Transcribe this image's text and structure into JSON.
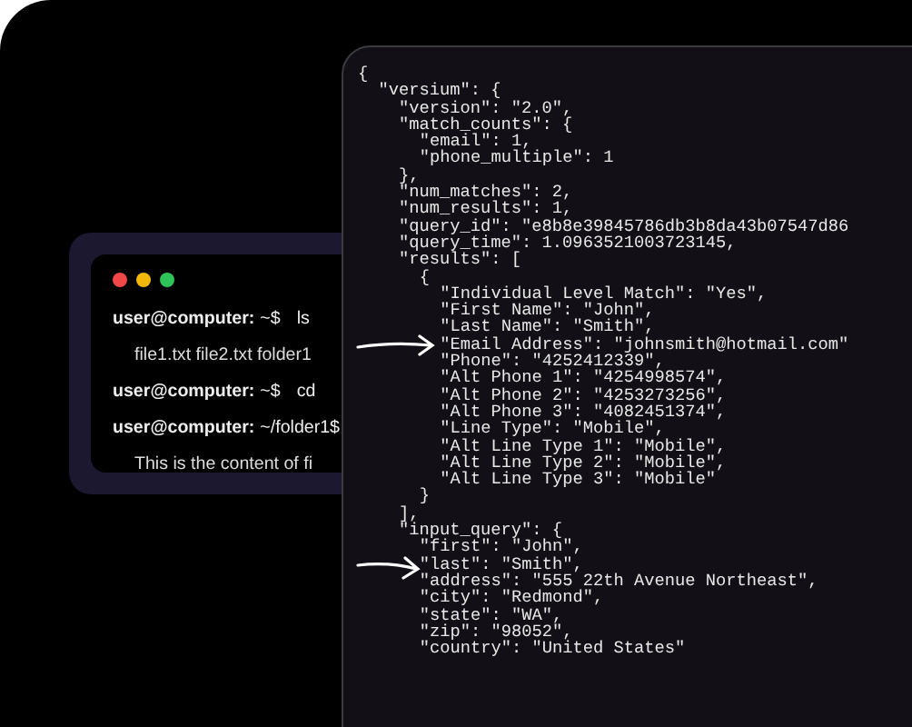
{
  "terminal": {
    "lines": [
      {
        "kind": "prompt",
        "user": "user@computer:",
        "path": "~$",
        "command": "ls"
      },
      {
        "kind": "output",
        "text": "file1.txt file2.txt folder1"
      },
      {
        "kind": "prompt",
        "user": "user@computer:",
        "path": "~$",
        "command": "cd"
      },
      {
        "kind": "prompt",
        "user": "user@computer:",
        "path": "~/folder1$"
      },
      {
        "kind": "output",
        "text": "This is the content of fi"
      }
    ]
  },
  "json_panel": {
    "lines": [
      "{",
      "  \"versium\": {",
      "    \"version\": \"2.0\",",
      "    \"match_counts\": {",
      "      \"email\": 1,",
      "      \"phone_multiple\": 1",
      "    },",
      "    \"num_matches\": 2,",
      "    \"num_results\": 1,",
      "    \"query_id\": \"e8b8e39845786db3b8da43b07547d86",
      "    \"query_time\": 1.0963521003723145,",
      "    \"results\": [",
      "      {",
      "        \"Individual Level Match\": \"Yes\",",
      "        \"First Name\": \"John\",",
      "        \"Last Name\": \"Smith\",",
      "        \"Email Address\": \"johnsmith@hotmail.com\"",
      "        \"Phone\": \"4252412339\",",
      "        \"Alt Phone 1\": \"4254998574\",",
      "        \"Alt Phone 2\": \"4253273256\",",
      "        \"Alt Phone 3\": \"4082451374\",",
      "        \"Line Type\": \"Mobile\",",
      "        \"Alt Line Type 1\": \"Mobile\",",
      "        \"Alt Line Type 2\": \"Mobile\",",
      "        \"Alt Line Type 3\": \"Mobile\"",
      "      }",
      "    ],",
      "    \"input_query\": {",
      "      \"first\": \"John\",",
      "      \"last\": \"Smith\",",
      "      \"address\": \"555 22th Avenue Northeast\",",
      "      \"city\": \"Redmond\",",
      "      \"state\": \"WA\",",
      "      \"zip\": \"98052\",",
      "      \"country\": \"United States\""
    ]
  }
}
